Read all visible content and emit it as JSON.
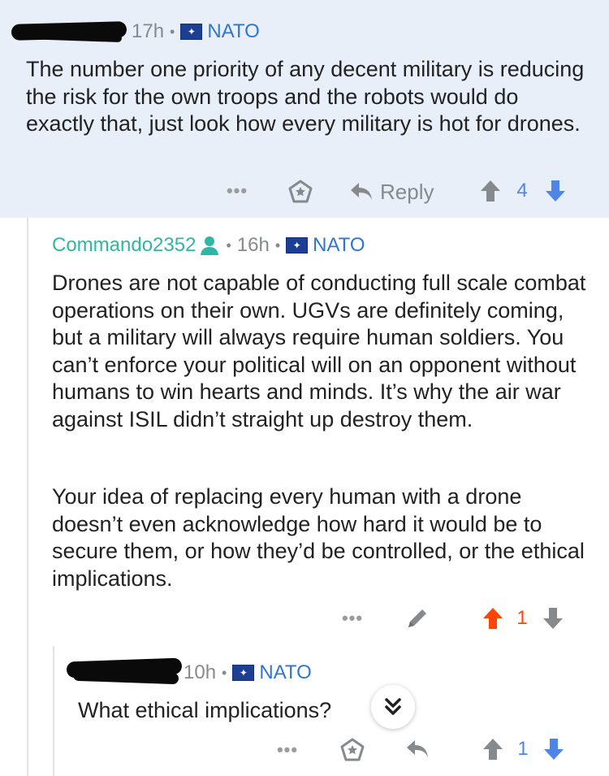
{
  "comments": [
    {
      "time": "17h",
      "flair": "NATO",
      "body": "The number one priority of any decent military is reducing the risk for the own troops and the robots would do exactly that, just look how every military is hot for drones.",
      "actions": {
        "more": "•••",
        "reply_label": "Reply",
        "score": "4",
        "score_color": "#4e86e8"
      }
    },
    {
      "username": "Commando2352",
      "time": "16h",
      "flair": "NATO",
      "paragraphs": [
        "Drones are not capable of conducting full scale combat operations on their own. UGVs are definitely coming, but a military will always require human soldiers. You can’t enforce your political will on an opponent without humans to win hearts and minds. It’s why the air war against ISIL didn’t straight up destroy them.",
        "Your idea of replacing every human with a drone doesn’t even acknowledge how hard it would be to secure them, or how they’d be controlled, or the ethical implications."
      ],
      "actions": {
        "more": "•••",
        "score": "1",
        "score_color": "#ff4500"
      }
    },
    {
      "time": "10h",
      "flair": "NATO",
      "body": "What ethical implications?",
      "actions": {
        "more": "•••",
        "score": "1",
        "score_color": "#4e86e8"
      }
    }
  ],
  "colors": {
    "upvoted": "#ff4500",
    "downvote_blue": "#4e86e8",
    "flair_blue": "#2f76d3",
    "username_green": "#2fb7a5",
    "highlight_bg": "#e8eff9"
  },
  "icons": [
    "nato-flag-icon",
    "award-icon",
    "reply-arrow-icon",
    "upvote-icon",
    "downvote-icon",
    "pencil-icon",
    "person-icon",
    "collapse-chevrons-icon"
  ]
}
